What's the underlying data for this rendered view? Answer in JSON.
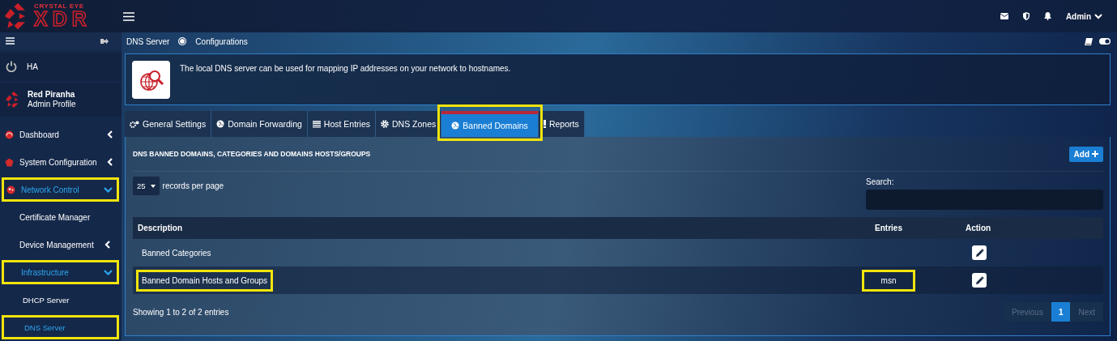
{
  "brand": {
    "tagline": "CRYSTAL EYE",
    "name": "XDR"
  },
  "topbar": {
    "user": "Admin"
  },
  "sidebar": {
    "status": "HA",
    "profile": {
      "name": "Red Piranha",
      "role": "Admin Profile"
    },
    "items": [
      {
        "label": "Dashboard",
        "expanded": false,
        "selected": false,
        "highlighted": false
      },
      {
        "label": "System Configuration",
        "expanded": false,
        "selected": false,
        "highlighted": false
      },
      {
        "label": "Network Control",
        "expanded": true,
        "selected": true,
        "highlighted": true,
        "children": [
          {
            "label": "Certificate Manager",
            "selected": false,
            "highlighted": false
          },
          {
            "label": "Device Management",
            "expanded": false,
            "selected": false,
            "highlighted": false
          },
          {
            "label": "Infrastructure",
            "expanded": true,
            "selected": true,
            "highlighted": true,
            "children": [
              {
                "label": "DHCP Server",
                "selected": false,
                "highlighted": false
              },
              {
                "label": "DNS Server",
                "selected": true,
                "highlighted": true
              }
            ]
          }
        ]
      }
    ]
  },
  "breadcrumb": [
    "DNS Server",
    "Configurations"
  ],
  "info": "The local DNS server can be used for mapping IP addresses on your network to hostnames.",
  "tabs": [
    {
      "label": "General Settings",
      "selected": false,
      "highlighted": false
    },
    {
      "label": "Domain Forwarding",
      "selected": false,
      "highlighted": false
    },
    {
      "label": "Host Entries",
      "selected": false,
      "highlighted": false
    },
    {
      "label": "DNS Zones",
      "selected": false,
      "highlighted": false
    },
    {
      "label": "Banned Domains",
      "selected": true,
      "highlighted": true
    },
    {
      "label": "Reports",
      "selected": false,
      "highlighted": false
    }
  ],
  "panel": {
    "title": "DNS BANNED DOMAINS, CATEGORIES AND DOMAINS HOSTS/GROUPS",
    "add_label": "Add",
    "page_size": "25",
    "page_size_label": "records per page",
    "search_label": "Search:",
    "columns": [
      "Description",
      "Entries",
      "Action"
    ],
    "rows": [
      {
        "description": "Banned Categories",
        "highlighted": false
      },
      {
        "description": "Banned Domain Hosts and Groups",
        "highlighted": true,
        "entries": "msn",
        "entries_highlighted": true
      }
    ],
    "summary": "Showing 1 to 2 of 2 entries",
    "pages": [
      {
        "label": "Previous",
        "kind": "prev",
        "disabled": true
      },
      {
        "label": "1",
        "kind": "page",
        "selected": true
      },
      {
        "label": "Next",
        "kind": "next",
        "disabled": true
      }
    ]
  }
}
